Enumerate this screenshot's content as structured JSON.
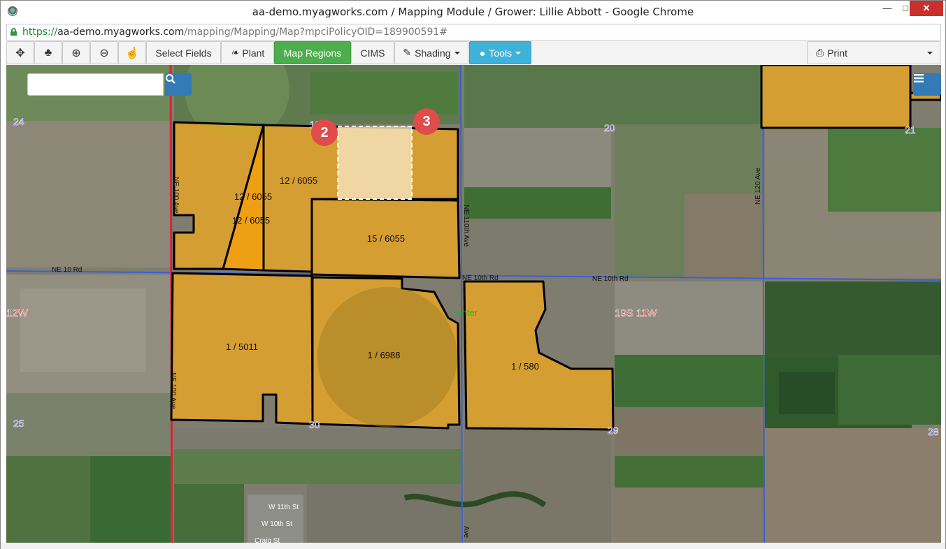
{
  "window": {
    "title": "aa-demo.myagworks.com / Mapping Module / Grower: Lillie Abbott - Google Chrome",
    "controls": {
      "minimize": "—",
      "maximize": "□",
      "close": "✕"
    }
  },
  "address": {
    "scheme": "https://",
    "host": "aa-demo.myagworks.com",
    "path": "/mapping/Mapping/Map?mpciPolicyOID=189900591#"
  },
  "toolbar": {
    "icon_buttons": [
      {
        "icon": "move-icon",
        "glyph": "✥"
      },
      {
        "icon": "tree-icon",
        "glyph": "♣"
      },
      {
        "icon": "zoom-in-icon",
        "glyph": "⊕"
      },
      {
        "icon": "zoom-out-icon",
        "glyph": "⊖"
      },
      {
        "icon": "pan-hand-icon",
        "glyph": "☝"
      }
    ],
    "select_fields": "Select Fields",
    "plant": "Plant",
    "map_regions": "Map Regions",
    "cims": "CIMS",
    "shading": "Shading",
    "tools": "Tools",
    "print": "Print",
    "colors": {
      "map_regions_bg": "#4cae4c",
      "tools_bg": "#3fb2d9",
      "search_bg": "#337ab7"
    }
  },
  "map": {
    "search": {
      "placeholder": ""
    },
    "badges": [
      "2",
      "3"
    ],
    "fields": [
      "12 / 6055",
      "12 / 6055",
      "12 / 6055",
      "15 / 6055",
      "1 / 5011",
      "1 / 6988",
      "1 / 580"
    ],
    "section_numbers": [
      "24",
      "20",
      "21",
      "25",
      "30",
      "29",
      "28",
      "19"
    ],
    "township_labels": [
      "12W",
      "19S 11W"
    ],
    "road_labels": [
      "NE 10 Rd",
      "NE 10th Rd",
      "NE 10th Rd",
      "NE 100 Ave",
      "NE 100 Ave",
      "NE 110th Ave",
      "NE 120 Ave",
      "Ave",
      "W 11th St",
      "W 10th St",
      "Craig St"
    ],
    "town_label": "Enter",
    "colors": {
      "field_fill": "#e8a625",
      "field_selected_fill": "#f4a10f",
      "field_outline": "#000000",
      "highlight_fill": "#f3dfb6",
      "badge": "#e04b4b"
    }
  }
}
